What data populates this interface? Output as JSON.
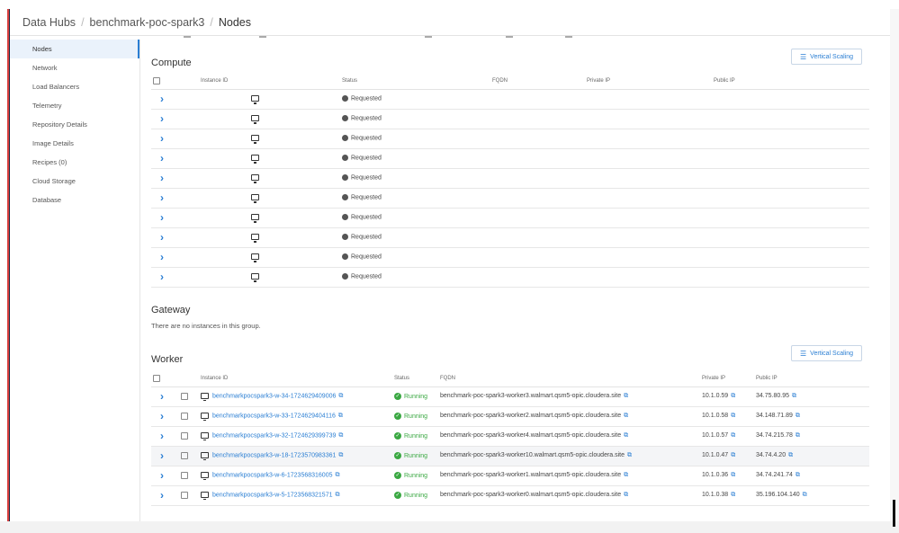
{
  "breadcrumb": {
    "root": "Data Hubs",
    "cluster": "benchmark-poc-spark3",
    "current": "Nodes",
    "separator": "/"
  },
  "sidebar": {
    "items": [
      {
        "label": "Nodes",
        "active": true
      },
      {
        "label": "Network"
      },
      {
        "label": "Load Balancers"
      },
      {
        "label": "Telemetry"
      },
      {
        "label": "Repository Details"
      },
      {
        "label": "Image Details"
      },
      {
        "label": "Recipes (0)"
      },
      {
        "label": "Cloud Storage"
      },
      {
        "label": "Database"
      }
    ]
  },
  "compute": {
    "title": "Compute",
    "button_label": "Vertical Scaling",
    "columns": {
      "instance_id": "Instance ID",
      "status": "Status",
      "fqdn": "FQDN",
      "private_ip": "Private IP",
      "public_ip": "Public IP"
    },
    "rows": [
      {
        "status": "Requested"
      },
      {
        "status": "Requested"
      },
      {
        "status": "Requested"
      },
      {
        "status": "Requested"
      },
      {
        "status": "Requested"
      },
      {
        "status": "Requested"
      },
      {
        "status": "Requested"
      },
      {
        "status": "Requested"
      },
      {
        "status": "Requested"
      },
      {
        "status": "Requested"
      }
    ]
  },
  "gateway": {
    "title": "Gateway",
    "empty_text": "There are no instances in this group."
  },
  "worker": {
    "title": "Worker",
    "button_label": "Vertical Scaling",
    "columns": {
      "instance_id": "Instance ID",
      "status": "Status",
      "fqdn": "FQDN",
      "private_ip": "Private IP",
      "public_ip": "Public IP"
    },
    "rows": [
      {
        "id": "benchmarkpocspark3-w-34-1724629409006",
        "status": "Running",
        "fqdn": "benchmark-poc-spark3-worker3.walmart.qsm5-opic.cloudera.site",
        "private_ip": "10.1.0.59",
        "public_ip": "34.75.80.95"
      },
      {
        "id": "benchmarkpocspark3-w-33-1724629404116",
        "status": "Running",
        "fqdn": "benchmark-poc-spark3-worker2.walmart.qsm5-opic.cloudera.site",
        "private_ip": "10.1.0.58",
        "public_ip": "34.148.71.89"
      },
      {
        "id": "benchmarkpocspark3-w-32-1724629399739",
        "status": "Running",
        "fqdn": "benchmark-poc-spark3-worker4.walmart.qsm5-opic.cloudera.site",
        "private_ip": "10.1.0.57",
        "public_ip": "34.74.215.78"
      },
      {
        "id": "benchmarkpocspark3-w-18-1723570983361",
        "status": "Running",
        "fqdn": "benchmark-poc-spark3-worker10.walmart.qsm5-opic.cloudera.site",
        "private_ip": "10.1.0.47",
        "public_ip": "34.74.4.20",
        "highlight": true
      },
      {
        "id": "benchmarkpocspark3-w-6-1723568316005",
        "status": "Running",
        "fqdn": "benchmark-poc-spark3-worker1.walmart.qsm5-opic.cloudera.site",
        "private_ip": "10.1.0.36",
        "public_ip": "34.74.241.74"
      },
      {
        "id": "benchmarkpocspark3-w-5-1723568321571",
        "status": "Running",
        "fqdn": "benchmark-poc-spark3-worker0.walmart.qsm5-opic.cloudera.site",
        "private_ip": "10.1.0.38",
        "public_ip": "35.196.104.140"
      }
    ]
  },
  "colors": {
    "accent": "#2a7ed3",
    "running": "#3aa842",
    "requested": "#555555",
    "brand_bar": "#d94040"
  },
  "icons": {
    "expand": "chevron-right-icon",
    "instance": "monitor-icon",
    "copy": "copy-icon",
    "scaling": "sliders-icon",
    "status_ok": "check-circle-icon",
    "status_pending": "dot-icon"
  }
}
